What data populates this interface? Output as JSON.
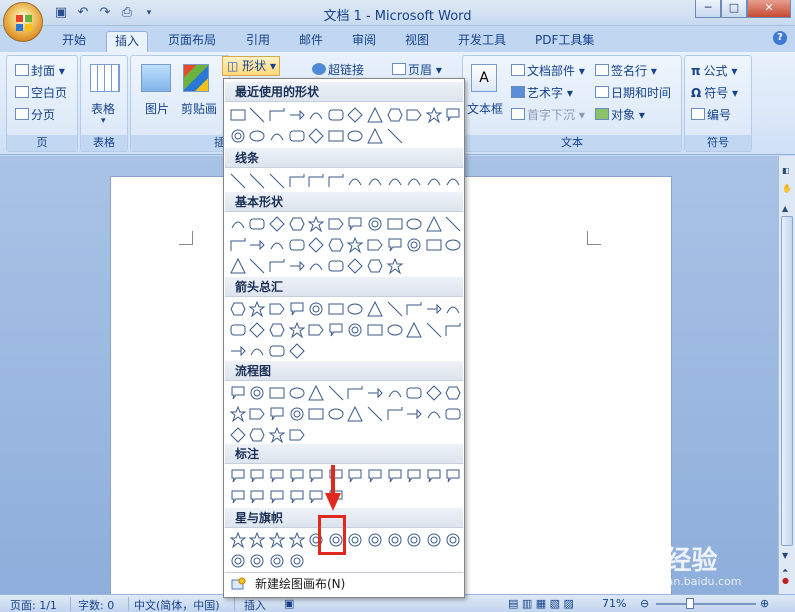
{
  "window": {
    "title": "文档 1 - Microsoft Word",
    "buttons": {
      "minimize": "─",
      "maximize": "□",
      "close": "✕"
    }
  },
  "tabs": [
    {
      "label": "开始",
      "active": false
    },
    {
      "label": "插入",
      "active": true
    },
    {
      "label": "页面布局",
      "active": false
    },
    {
      "label": "引用",
      "active": false
    },
    {
      "label": "邮件",
      "active": false
    },
    {
      "label": "审阅",
      "active": false
    },
    {
      "label": "视图",
      "active": false
    },
    {
      "label": "开发工具",
      "active": false
    },
    {
      "label": "PDF工具集",
      "active": false
    }
  ],
  "ribbon": {
    "groups": {
      "pages": {
        "label": "页",
        "items": [
          "封面 ▾",
          "空白页",
          "分页"
        ]
      },
      "tables": {
        "label": "表格",
        "items": [
          "表格"
        ]
      },
      "illustrations": {
        "label": "插图",
        "items": [
          "图片",
          "剪贴画",
          "形状 ▾",
          "超链接"
        ]
      },
      "header": {
        "items": [
          "页眉 ▾"
        ]
      },
      "text": {
        "label": "文本",
        "items": [
          "文本框",
          "文档部件 ▾",
          "艺术字 ▾",
          "首字下沉 ▾",
          "签名行 ▾",
          "日期和时间",
          "对象 ▾"
        ]
      },
      "symbols": {
        "label": "符号",
        "items": [
          "公式 ▾",
          "符号 ▾",
          "编号"
        ]
      }
    },
    "group_label_illus_partial": "插"
  },
  "dropdown": {
    "sections": [
      {
        "title": "最近使用的形状",
        "rows": 2
      },
      {
        "title": "线条",
        "rows": 1
      },
      {
        "title": "基本形状",
        "rows": 3
      },
      {
        "title": "箭头总汇",
        "rows": 3
      },
      {
        "title": "流程图",
        "rows": 3
      },
      {
        "title": "标注",
        "rows": 2
      },
      {
        "title": "星与旗帜",
        "rows": 2
      }
    ],
    "footer": "新建绘图画布(N)"
  },
  "statusbar": {
    "page": "页面: 1/1",
    "words": "字数: 0",
    "language": "中文(简体，中国)",
    "mode": "插入",
    "zoom": "71%"
  },
  "watermark": {
    "brand": "Bai 经验",
    "sub": "jingyan.baidu.com"
  }
}
